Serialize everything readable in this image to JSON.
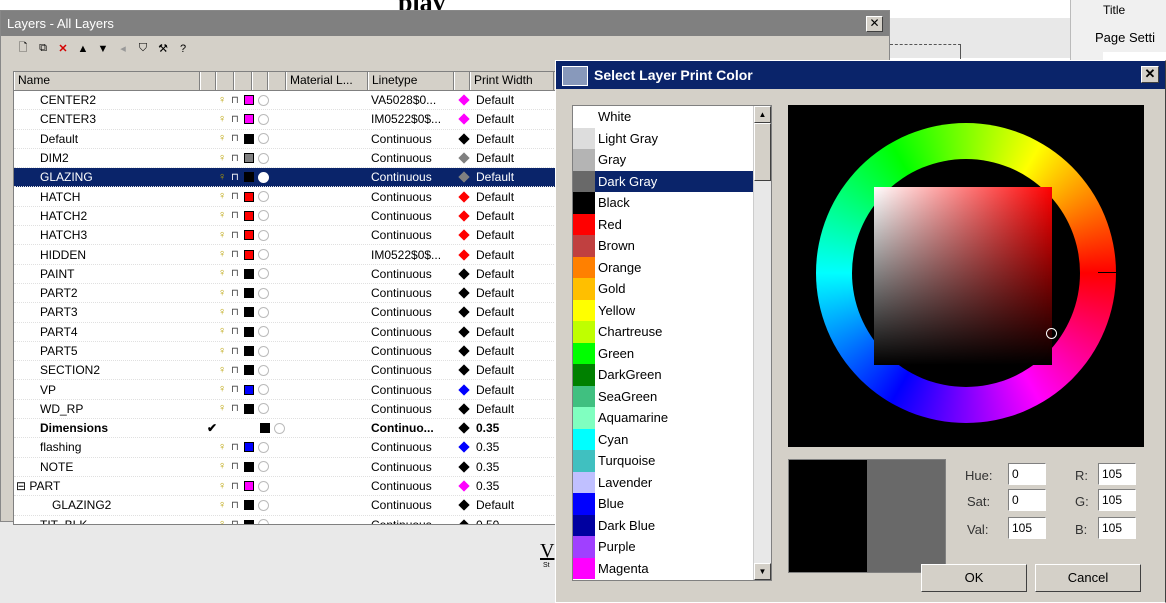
{
  "background": {
    "heading": "play",
    "right_title": "Title",
    "right_page": "Page Setti",
    "lower_v": "V",
    "lower_small": "St"
  },
  "layers_panel": {
    "title": "Layers - All Layers",
    "close": "✕",
    "toolbar_icons": [
      "new-layer-icon",
      "new-sublayer-icon",
      "delete-icon",
      "move-up-icon",
      "move-down-icon",
      "move-out-icon",
      "filter-icon",
      "tools-icon",
      "help-icon"
    ],
    "columns": {
      "name": "Name",
      "material": "Material L...",
      "linetype": "Linetype",
      "print_width": "Print Width"
    },
    "rows": [
      {
        "name": "CENTER2",
        "color": "#ff00ff",
        "linetype": "VA5028$0...",
        "pc": "#ff00ff",
        "pw": "Default"
      },
      {
        "name": "CENTER3",
        "color": "#ff00ff",
        "linetype": "IM0522$0$...",
        "pc": "#ff00ff",
        "pw": "Default"
      },
      {
        "name": "Default",
        "color": "#000000",
        "linetype": "Continuous",
        "pc": "#000000",
        "pw": "Default"
      },
      {
        "name": "DIM2",
        "color": "#808080",
        "linetype": "Continuous",
        "pc": "#808080",
        "pw": "Default"
      },
      {
        "name": "GLAZING",
        "color": "#000000",
        "linetype": "Continuous",
        "pc": "#808080",
        "pw": "Default",
        "selected": true
      },
      {
        "name": "HATCH",
        "color": "#ff0000",
        "linetype": "Continuous",
        "pc": "#ff0000",
        "pw": "Default"
      },
      {
        "name": "HATCH2",
        "color": "#ff0000",
        "linetype": "Continuous",
        "pc": "#ff0000",
        "pw": "Default"
      },
      {
        "name": "HATCH3",
        "color": "#ff0000",
        "linetype": "Continuous",
        "pc": "#ff0000",
        "pw": "Default"
      },
      {
        "name": "HIDDEN",
        "color": "#ff0000",
        "linetype": "IM0522$0$...",
        "pc": "#ff0000",
        "pw": "Default"
      },
      {
        "name": "PAINT",
        "color": "#000000",
        "linetype": "Continuous",
        "pc": "#000000",
        "pw": "Default"
      },
      {
        "name": "PART2",
        "color": "#000000",
        "linetype": "Continuous",
        "pc": "#000000",
        "pw": "Default"
      },
      {
        "name": "PART3",
        "color": "#000000",
        "linetype": "Continuous",
        "pc": "#000000",
        "pw": "Default"
      },
      {
        "name": "PART4",
        "color": "#000000",
        "linetype": "Continuous",
        "pc": "#000000",
        "pw": "Default"
      },
      {
        "name": "PART5",
        "color": "#000000",
        "linetype": "Continuous",
        "pc": "#000000",
        "pw": "Default"
      },
      {
        "name": "SECTION2",
        "color": "#000000",
        "linetype": "Continuous",
        "pc": "#000000",
        "pw": "Default"
      },
      {
        "name": "VP",
        "color": "#0000ff",
        "linetype": "Continuous",
        "pc": "#0000ff",
        "pw": "Default"
      },
      {
        "name": "WD_RP",
        "color": "#000000",
        "linetype": "Continuous",
        "pc": "#000000",
        "pw": "Default"
      },
      {
        "name": "Dimensions",
        "color": "#000000",
        "linetype": "Continuo...",
        "pc": "#000000",
        "pw": "0.35",
        "bold": true,
        "check": "✔"
      },
      {
        "name": "flashing",
        "color": "#0000ff",
        "linetype": "Continuous",
        "pc": "#0000ff",
        "pw": "0.35",
        "indent": 0
      },
      {
        "name": "NOTE",
        "color": "#000000",
        "linetype": "Continuous",
        "pc": "#000000",
        "pw": "0.35",
        "indent": 0
      },
      {
        "name": "PART",
        "color": "#ff00ff",
        "linetype": "Continuous",
        "pc": "#ff00ff",
        "pw": "0.35",
        "indent": 0,
        "expand": "⊟"
      },
      {
        "name": "GLAZING2",
        "color": "#000000",
        "linetype": "Continuous",
        "pc": "#000000",
        "pw": "Default",
        "indent": 1
      },
      {
        "name": "TIT_BLK",
        "color": "#000000",
        "linetype": "Continuous",
        "pc": "#000000",
        "pw": "0.50",
        "indent": 0
      }
    ]
  },
  "dialog": {
    "title": "Select Layer Print Color",
    "close": "✕",
    "colors": [
      {
        "name": "White",
        "hex": "#ffffff"
      },
      {
        "name": "Light Gray",
        "hex": "#dddddd"
      },
      {
        "name": "Gray",
        "hex": "#b4b4b4"
      },
      {
        "name": "Dark Gray",
        "hex": "#696969",
        "selected": true
      },
      {
        "name": "Black",
        "hex": "#000000"
      },
      {
        "name": "Red",
        "hex": "#ff0000"
      },
      {
        "name": "Brown",
        "hex": "#c04040"
      },
      {
        "name": "Orange",
        "hex": "#ff8000"
      },
      {
        "name": "Gold",
        "hex": "#ffbf00"
      },
      {
        "name": "Yellow",
        "hex": "#ffff00"
      },
      {
        "name": "Chartreuse",
        "hex": "#bfff00"
      },
      {
        "name": "Green",
        "hex": "#00ff00"
      },
      {
        "name": "DarkGreen",
        "hex": "#008000"
      },
      {
        "name": "SeaGreen",
        "hex": "#40c080"
      },
      {
        "name": "Aquamarine",
        "hex": "#80ffc0"
      },
      {
        "name": "Cyan",
        "hex": "#00ffff"
      },
      {
        "name": "Turquoise",
        "hex": "#40c0c0"
      },
      {
        "name": "Lavender",
        "hex": "#c0c0ff"
      },
      {
        "name": "Blue",
        "hex": "#0000ff"
      },
      {
        "name": "Dark Blue",
        "hex": "#0000a0"
      },
      {
        "name": "Purple",
        "hex": "#a040ff"
      },
      {
        "name": "Magenta",
        "hex": "#ff00ff"
      }
    ],
    "preview_new": "#696969",
    "fields": {
      "hue_label": "Hue:",
      "hue": "0",
      "sat_label": "Sat:",
      "sat": "0",
      "val_label": "Val:",
      "val": "105",
      "r_label": "R:",
      "r": "105",
      "g_label": "G:",
      "g": "105",
      "b_label": "B:",
      "b": "105"
    },
    "ok": "OK",
    "cancel": "Cancel"
  }
}
